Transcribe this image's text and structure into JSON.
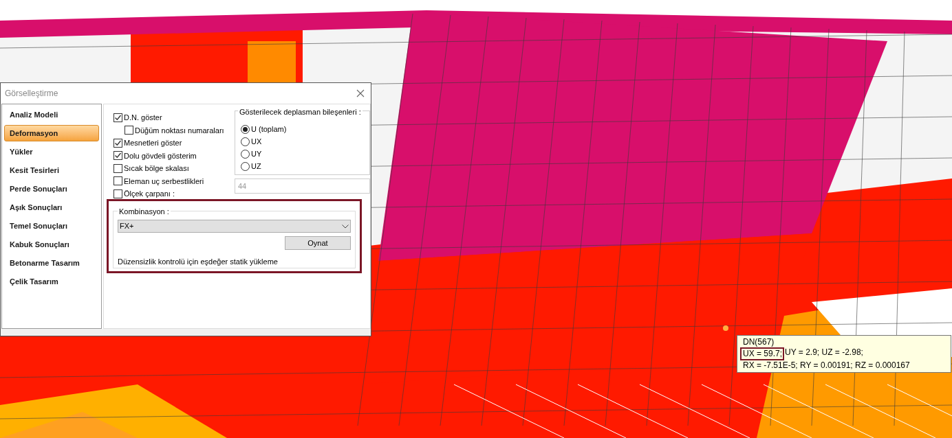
{
  "dialog": {
    "title": "Görselleştirme",
    "sidebar": {
      "items": [
        {
          "label": "Analiz Modeli",
          "selected": false
        },
        {
          "label": "Deformasyon",
          "selected": true
        },
        {
          "label": "Yükler",
          "selected": false
        },
        {
          "label": "Kesit Tesirleri",
          "selected": false
        },
        {
          "label": "Perde Sonuçları",
          "selected": false
        },
        {
          "label": "Aşık Sonuçları",
          "selected": false
        },
        {
          "label": "Temel Sonuçları",
          "selected": false
        },
        {
          "label": "Kabuk Sonuçları",
          "selected": false
        },
        {
          "label": "Betonarme Tasarım",
          "selected": false
        },
        {
          "label": "Çelik Tasarım",
          "selected": false
        }
      ]
    },
    "options": [
      {
        "label": "D.N. göster",
        "checked": true,
        "children": [
          {
            "label": "Düğüm noktası numaraları",
            "checked": false
          }
        ]
      },
      {
        "label": "Mesnetleri göster",
        "checked": true
      },
      {
        "label": "Dolu gövdeli gösterim",
        "checked": true
      },
      {
        "label": "Sıcak bölge skalası",
        "checked": false
      },
      {
        "label": "Eleman uç serbestlikleri",
        "checked": false
      },
      {
        "label": "Ölçek çarpanı :",
        "checked": false
      }
    ],
    "scale_field": {
      "value": "44"
    },
    "components": {
      "title": "Gösterilecek deplasman bileşenleri :",
      "options": [
        {
          "label": "U (toplam)",
          "selected": true
        },
        {
          "label": "UX",
          "selected": false
        },
        {
          "label": "UY",
          "selected": false
        },
        {
          "label": "UZ",
          "selected": false
        }
      ]
    },
    "combination": {
      "title": "Kombinasyon :",
      "value": "FX+",
      "button": "Oynat",
      "description": "Düzensizlik kontrolü için eşdeğer statik yükleme"
    }
  },
  "tooltip": {
    "title": "DN(567)",
    "highlight": "UX = 59.7;",
    "line_2_rest": "UY = 2.9; UZ = -2.98;",
    "line_3": "RX = -7.51E-5; RY = 0.00191; RZ = 0.000167"
  }
}
